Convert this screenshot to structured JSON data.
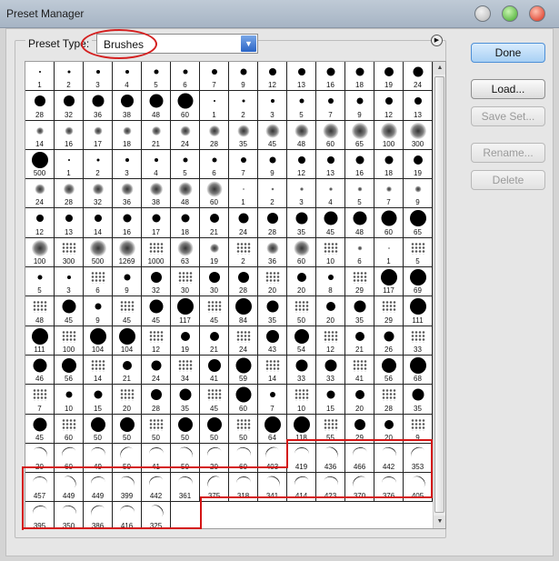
{
  "window": {
    "title": "Preset Manager"
  },
  "preset": {
    "label": "Preset Type:",
    "value": "Brushes"
  },
  "buttons": {
    "done": "Done",
    "load": "Load...",
    "save_set": "Save Set...",
    "rename": "Rename...",
    "delete": "Delete"
  },
  "brushes": [
    "1",
    "2",
    "3",
    "4",
    "5",
    "6",
    "7",
    "9",
    "12",
    "13",
    "16",
    "18",
    "19",
    "24",
    "28",
    "32",
    "36",
    "38",
    "48",
    "60",
    "1",
    "2",
    "3",
    "5",
    "7",
    "9",
    "12",
    "13",
    "14",
    "16",
    "17",
    "18",
    "21",
    "24",
    "28",
    "35",
    "45",
    "48",
    "60",
    "65",
    "100",
    "300",
    "500",
    "1",
    "2",
    "3",
    "4",
    "5",
    "6",
    "7",
    "9",
    "12",
    "13",
    "16",
    "18",
    "19",
    "24",
    "28",
    "32",
    "36",
    "38",
    "48",
    "60",
    "1",
    "2",
    "3",
    "4",
    "5",
    "7",
    "9",
    "12",
    "13",
    "14",
    "16",
    "17",
    "18",
    "21",
    "24",
    "28",
    "35",
    "45",
    "48",
    "60",
    "65",
    "100",
    "300",
    "500",
    "1269",
    "1000",
    "63",
    "19",
    "2",
    "36",
    "60",
    "10",
    "6",
    "1",
    "5",
    "5",
    "3",
    "6",
    "9",
    "32",
    "30",
    "30",
    "28",
    "20",
    "20",
    "8",
    "29",
    "117",
    "69",
    "48",
    "45",
    "9",
    "45",
    "45",
    "117",
    "45",
    "84",
    "35",
    "50",
    "20",
    "35",
    "29",
    "111",
    "111",
    "100",
    "104",
    "104",
    "12",
    "19",
    "21",
    "24",
    "43",
    "54",
    "12",
    "21",
    "26",
    "33",
    "46",
    "56",
    "14",
    "21",
    "24",
    "34",
    "41",
    "59",
    "14",
    "33",
    "33",
    "41",
    "56",
    "68",
    "7",
    "10",
    "15",
    "20",
    "28",
    "35",
    "45",
    "60",
    "7",
    "10",
    "15",
    "20",
    "28",
    "35",
    "45",
    "60",
    "50",
    "50",
    "50",
    "50",
    "50",
    "50",
    "64",
    "118",
    "55",
    "29",
    "20",
    "9",
    "20",
    "60",
    "49",
    "50",
    "41",
    "50",
    "20",
    "60",
    "403",
    "419",
    "436",
    "466",
    "442",
    "353",
    "457",
    "449",
    "449",
    "399",
    "442",
    "361",
    "375",
    "318",
    "341",
    "414",
    "423",
    "370",
    "376",
    "405",
    "395",
    "350",
    "386",
    "416",
    "325"
  ]
}
